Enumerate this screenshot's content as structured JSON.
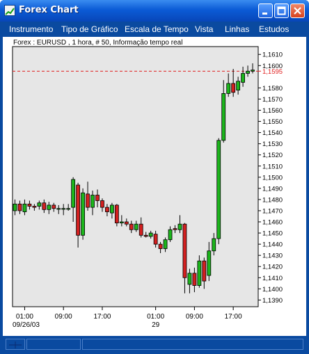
{
  "window": {
    "title": "Forex Chart"
  },
  "menu": [
    "Instrumento",
    "Tipo de Gráfico",
    "Escala de Tempo",
    "Vista",
    "Linhas",
    "Estudos"
  ],
  "chart_info": "Forex : EURUSD , 1 hora, # 50, Informação tempo real",
  "chart_data": {
    "type": "candlestick",
    "instrument": "EURUSD",
    "current_price_label": "1,1595",
    "current_price": 1.1595,
    "ylim": [
      1.1384,
      1.1617
    ],
    "y_ticks": [
      "1,1610",
      "1,1600",
      "1,1595",
      "1,1580",
      "1,1570",
      "1,1560",
      "1,1550",
      "1,1540",
      "1,1530",
      "1,1520",
      "1,1510",
      "1,1500",
      "1,1490",
      "1,1480",
      "1,1470",
      "1,1460",
      "1,1450",
      "1,1440",
      "1,1430",
      "1,1420",
      "1,1410",
      "1,1400",
      "1,1390"
    ],
    "x_ticks": [
      "01:00",
      "09:00",
      "17:00",
      "01:00",
      "09:00",
      "17:00"
    ],
    "x_date_labels": [
      "09/26/03",
      "29"
    ],
    "candles": [
      {
        "o": 1.147,
        "c": 1.1476,
        "h": 1.148,
        "l": 1.1466
      },
      {
        "o": 1.1476,
        "c": 1.147,
        "h": 1.1479,
        "l": 1.1467
      },
      {
        "o": 1.1469,
        "c": 1.1476,
        "h": 1.148,
        "l": 1.1466
      },
      {
        "o": 1.1476,
        "c": 1.1474,
        "h": 1.1479,
        "l": 1.1471
      },
      {
        "o": 1.1474,
        "c": 1.1473,
        "h": 1.1476,
        "l": 1.147
      },
      {
        "o": 1.1474,
        "c": 1.1477,
        "h": 1.1479,
        "l": 1.1471
      },
      {
        "o": 1.1477,
        "c": 1.1471,
        "h": 1.148,
        "l": 1.1468
      },
      {
        "o": 1.1471,
        "c": 1.1475,
        "h": 1.1478,
        "l": 1.1467
      },
      {
        "o": 1.1475,
        "c": 1.1472,
        "h": 1.1477,
        "l": 1.1469
      },
      {
        "o": 1.1472,
        "c": 1.1472,
        "h": 1.1475,
        "l": 1.1467
      },
      {
        "o": 1.1472,
        "c": 1.1472,
        "h": 1.1476,
        "l": 1.1466
      },
      {
        "o": 1.1472,
        "c": 1.1472,
        "h": 1.1476,
        "l": 1.147
      },
      {
        "o": 1.1473,
        "c": 1.1498,
        "h": 1.15,
        "l": 1.146
      },
      {
        "o": 1.1493,
        "c": 1.1448,
        "h": 1.1495,
        "l": 1.1437
      },
      {
        "o": 1.1448,
        "c": 1.1486,
        "h": 1.149,
        "l": 1.1444
      },
      {
        "o": 1.1485,
        "c": 1.1473,
        "h": 1.1496,
        "l": 1.147
      },
      {
        "o": 1.1473,
        "c": 1.1484,
        "h": 1.1488,
        "l": 1.1466
      },
      {
        "o": 1.1484,
        "c": 1.1479,
        "h": 1.1489,
        "l": 1.1473
      },
      {
        "o": 1.1479,
        "c": 1.1473,
        "h": 1.1481,
        "l": 1.1469
      },
      {
        "o": 1.1473,
        "c": 1.1469,
        "h": 1.1476,
        "l": 1.1465
      },
      {
        "o": 1.1468,
        "c": 1.1475,
        "h": 1.1477,
        "l": 1.1463
      },
      {
        "o": 1.1475,
        "c": 1.1459,
        "h": 1.1476,
        "l": 1.1456
      },
      {
        "o": 1.1459,
        "c": 1.146,
        "h": 1.1466,
        "l": 1.1456
      },
      {
        "o": 1.146,
        "c": 1.1458,
        "h": 1.1463,
        "l": 1.1456
      },
      {
        "o": 1.1458,
        "c": 1.1453,
        "h": 1.1461,
        "l": 1.145
      },
      {
        "o": 1.1453,
        "c": 1.1458,
        "h": 1.1461,
        "l": 1.1451
      },
      {
        "o": 1.1458,
        "c": 1.1448,
        "h": 1.1464,
        "l": 1.1446
      },
      {
        "o": 1.1448,
        "c": 1.1447,
        "h": 1.1451,
        "l": 1.1446
      },
      {
        "o": 1.1447,
        "c": 1.145,
        "h": 1.1452,
        "l": 1.1445
      },
      {
        "o": 1.1449,
        "c": 1.144,
        "h": 1.1452,
        "l": 1.1437
      },
      {
        "o": 1.144,
        "c": 1.1436,
        "h": 1.1442,
        "l": 1.1432
      },
      {
        "o": 1.1436,
        "c": 1.1444,
        "h": 1.1446,
        "l": 1.1433
      },
      {
        "o": 1.1444,
        "c": 1.1453,
        "h": 1.1456,
        "l": 1.1442
      },
      {
        "o": 1.1454,
        "c": 1.1453,
        "h": 1.1457,
        "l": 1.145
      },
      {
        "o": 1.1453,
        "c": 1.1458,
        "h": 1.1466,
        "l": 1.145
      },
      {
        "o": 1.1458,
        "c": 1.141,
        "h": 1.1459,
        "l": 1.1396
      },
      {
        "o": 1.1404,
        "c": 1.1414,
        "h": 1.1418,
        "l": 1.1396
      },
      {
        "o": 1.1414,
        "c": 1.1403,
        "h": 1.1419,
        "l": 1.1397
      },
      {
        "o": 1.1403,
        "c": 1.1425,
        "h": 1.143,
        "l": 1.1401
      },
      {
        "o": 1.1425,
        "c": 1.1407,
        "h": 1.1428,
        "l": 1.14
      },
      {
        "o": 1.1412,
        "c": 1.1434,
        "h": 1.1442,
        "l": 1.1407
      },
      {
        "o": 1.1434,
        "c": 1.1445,
        "h": 1.145,
        "l": 1.143
      },
      {
        "o": 1.1445,
        "c": 1.1533,
        "h": 1.1535,
        "l": 1.144
      },
      {
        "o": 1.1533,
        "c": 1.1575,
        "h": 1.1587,
        "l": 1.1531
      },
      {
        "o": 1.1575,
        "c": 1.1584,
        "h": 1.1593,
        "l": 1.1572
      },
      {
        "o": 1.1584,
        "c": 1.1576,
        "h": 1.1597,
        "l": 1.1572
      },
      {
        "o": 1.1578,
        "c": 1.1586,
        "h": 1.159,
        "l": 1.1574
      },
      {
        "o": 1.1585,
        "c": 1.1593,
        "h": 1.1599,
        "l": 1.1581
      },
      {
        "o": 1.1593,
        "c": 1.1595,
        "h": 1.16,
        "l": 1.159
      },
      {
        "o": 1.1595,
        "c": 1.1596,
        "h": 1.1602,
        "l": 1.1593
      }
    ]
  },
  "colors": {
    "window_frame": "#0a4aa0",
    "plot_background": "#e6e6e6",
    "bull_candle": "#1cb51c",
    "bear_candle": "#d32020",
    "current_price_line": "#e02020"
  },
  "icons": [
    "forex-chart-app-icon",
    "minimize-icon",
    "maximize-icon",
    "close-icon",
    "crosshair-icon"
  ]
}
